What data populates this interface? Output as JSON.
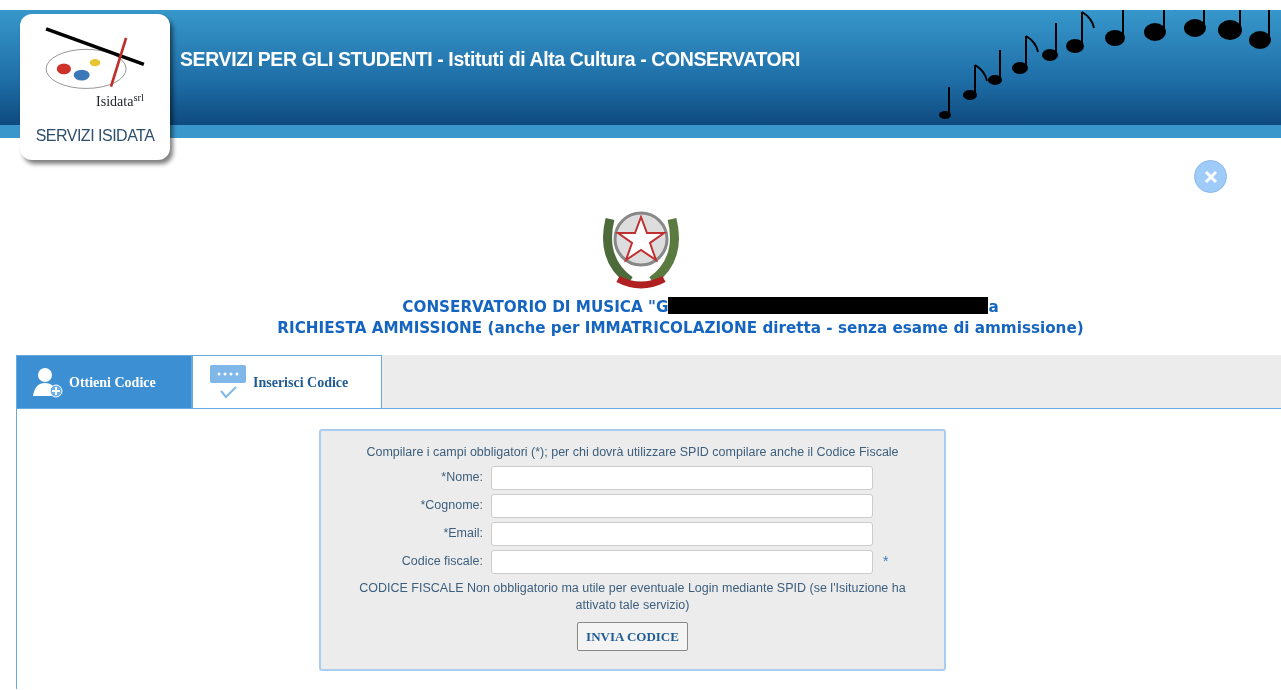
{
  "header": {
    "logo_wordmark": "Isidata$^{srl}$",
    "logo_caption": "SERVIZI ISIDATA",
    "title": "SERVIZI PER GLI STUDENTI - Istituti di Alta Cultura - CONSERVATORI"
  },
  "institution": {
    "name_start": "CONSERVATORIO DI MUSICA \"G",
    "name_end": "a",
    "redacted": true
  },
  "request_title": "RICHIESTA AMMISSIONE (anche per IMMATRICOLAZIONE diretta - senza esame di ammissione)",
  "tabs": [
    {
      "label": "Ottieni Codice",
      "selected": true,
      "kind": "person"
    },
    {
      "label": "Inserisci Codice",
      "selected": false,
      "kind": "code"
    }
  ],
  "form": {
    "intro": "Compilare i campi obbligatori (*); per chi dovrà utilizzare SPID compilare anche il Codice Fiscale",
    "fields": [
      {
        "label": "*Nome:"
      },
      {
        "label": "*Cognome:"
      },
      {
        "label": "*Email:"
      },
      {
        "label": "Codice fiscale:",
        "mark": "*"
      }
    ],
    "note": "CODICE FISCALE Non obbligatorio ma utile per eventuale Login mediante SPID (se l'Isituzione ha attivato tale servizio)",
    "submit": "INVIA CODICE"
  }
}
